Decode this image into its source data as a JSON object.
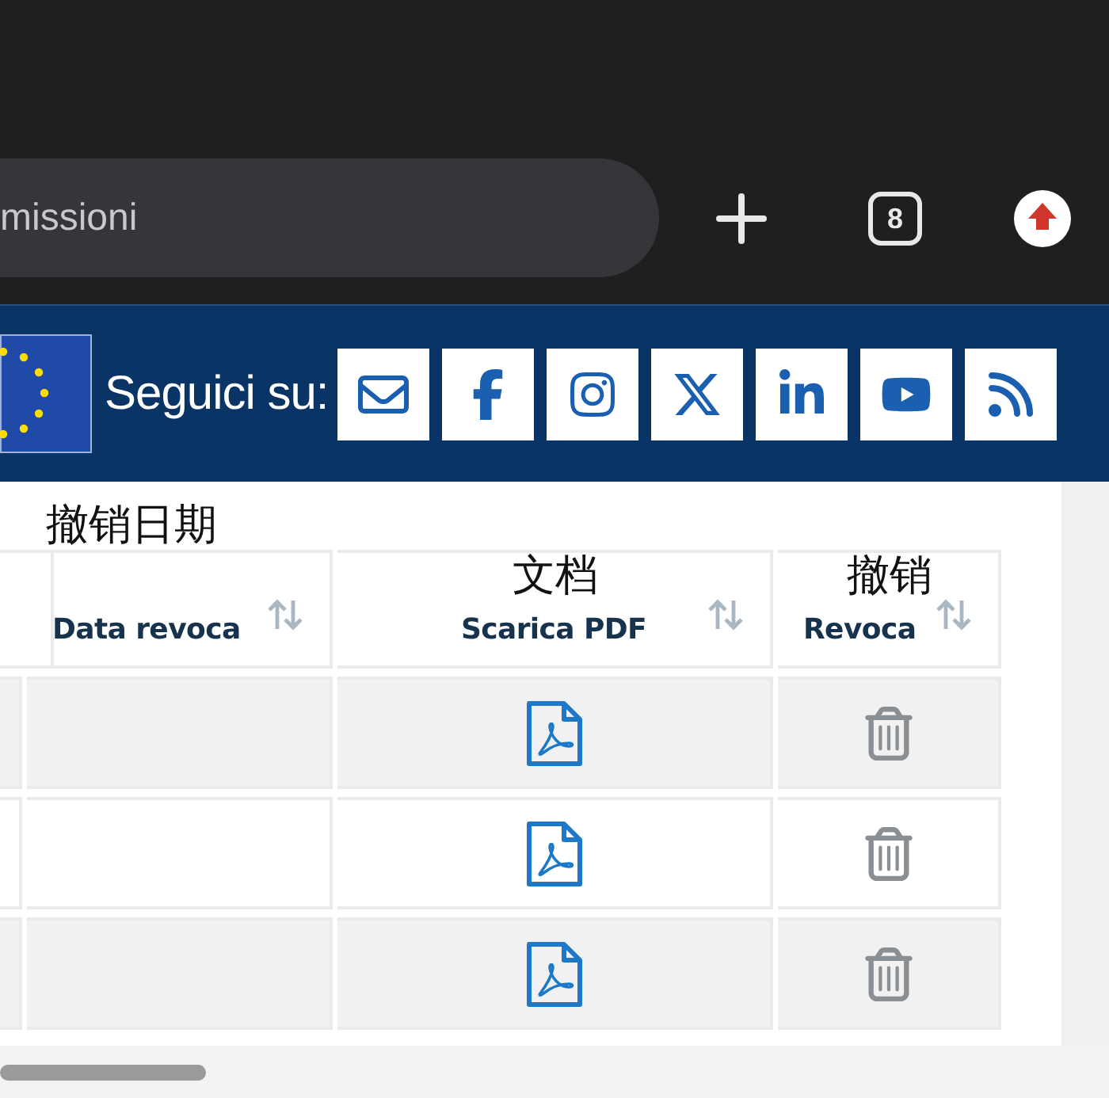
{
  "browser": {
    "address_text": "missioni",
    "tab_count": "8"
  },
  "banner": {
    "follow_label": "Seguici su:",
    "social": [
      {
        "kind": "email"
      },
      {
        "kind": "facebook"
      },
      {
        "kind": "instagram"
      },
      {
        "kind": "x"
      },
      {
        "kind": "linkedin"
      },
      {
        "kind": "youtube"
      },
      {
        "kind": "rss"
      }
    ]
  },
  "table": {
    "columns": [
      {
        "kind": "cut"
      },
      {
        "kind": "date",
        "annotation": "撤销日期",
        "label": "Data revoca"
      },
      {
        "kind": "document",
        "annotation": "文档",
        "label": "Scarica PDF"
      },
      {
        "kind": "action",
        "annotation": "撤销",
        "label": "Revoca"
      }
    ],
    "rows": [
      {
        "cells": [
          {
            "kind": "empty"
          },
          {
            "kind": "empty"
          },
          {
            "kind": "pdf"
          },
          {
            "kind": "delete"
          }
        ]
      },
      {
        "cells": [
          {
            "kind": "empty"
          },
          {
            "kind": "empty"
          },
          {
            "kind": "pdf"
          },
          {
            "kind": "delete"
          }
        ]
      },
      {
        "cells": [
          {
            "kind": "empty"
          },
          {
            "kind": "empty"
          },
          {
            "kind": "pdf"
          },
          {
            "kind": "delete"
          }
        ]
      }
    ]
  }
}
